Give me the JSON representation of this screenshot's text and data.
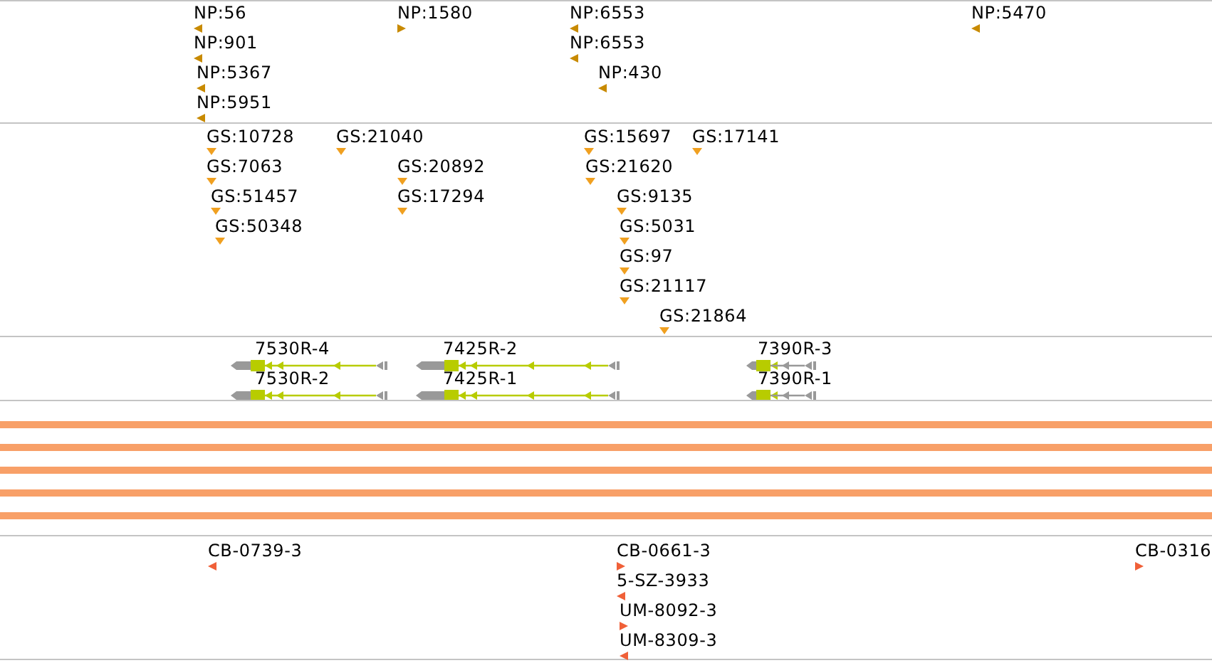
{
  "tracks": [
    {
      "kind": "markers",
      "color": "#c88a00",
      "features": [
        {
          "label": "NP:56",
          "kind": "reverse"
        },
        {
          "label": "NP:1580",
          "kind": "forward"
        },
        {
          "label": "NP:6553",
          "kind": "reverse"
        },
        {
          "label": "NP:5470",
          "kind": "reverse"
        },
        {
          "label": "NP:901",
          "kind": "reverse"
        },
        {
          "label": "NP:6553",
          "kind": "reverse"
        },
        {
          "label": "NP:5367",
          "kind": "reverse"
        },
        {
          "label": "NP:430",
          "kind": "reverse"
        },
        {
          "label": "NP:5951",
          "kind": "reverse"
        }
      ]
    },
    {
      "kind": "markers",
      "color": "#f0a020",
      "features": [
        {
          "label": "GS:10728",
          "kind": "tick"
        },
        {
          "label": "GS:21040",
          "kind": "tick"
        },
        {
          "label": "GS:15697",
          "kind": "tick"
        },
        {
          "label": "GS:17141",
          "kind": "tick"
        },
        {
          "label": "GS:7063",
          "kind": "tick"
        },
        {
          "label": "GS:20892",
          "kind": "tick"
        },
        {
          "label": "GS:21620",
          "kind": "tick"
        },
        {
          "label": "GS:51457",
          "kind": "tick"
        },
        {
          "label": "GS:17294",
          "kind": "tick"
        },
        {
          "label": "GS:9135",
          "kind": "tick"
        },
        {
          "label": "GS:50348",
          "kind": "tick"
        },
        {
          "label": "GS:5031",
          "kind": "tick"
        },
        {
          "label": "GS:97",
          "kind": "tick"
        },
        {
          "label": "GS:21117",
          "kind": "tick"
        },
        {
          "label": "GS:21864",
          "kind": "tick"
        }
      ]
    },
    {
      "kind": "genes",
      "features": [
        {
          "label": "7530R-4"
        },
        {
          "label": "7425R-2"
        },
        {
          "label": "7390R-3"
        },
        {
          "label": "7530R-2"
        },
        {
          "label": "7425R-1"
        },
        {
          "label": "7390R-1"
        }
      ]
    },
    {
      "kind": "coverage"
    },
    {
      "kind": "markers",
      "color": "#f06038",
      "features": [
        {
          "label": "CB-0739-3",
          "kind": "reverse"
        },
        {
          "label": "CB-0661-3",
          "kind": "forward"
        },
        {
          "label": "CB-0316",
          "kind": "forward"
        },
        {
          "label": "5-SZ-3933",
          "kind": "reverse"
        },
        {
          "label": "UM-8092-3",
          "kind": "forward"
        },
        {
          "label": "UM-8309-3",
          "kind": "reverse"
        }
      ]
    }
  ]
}
